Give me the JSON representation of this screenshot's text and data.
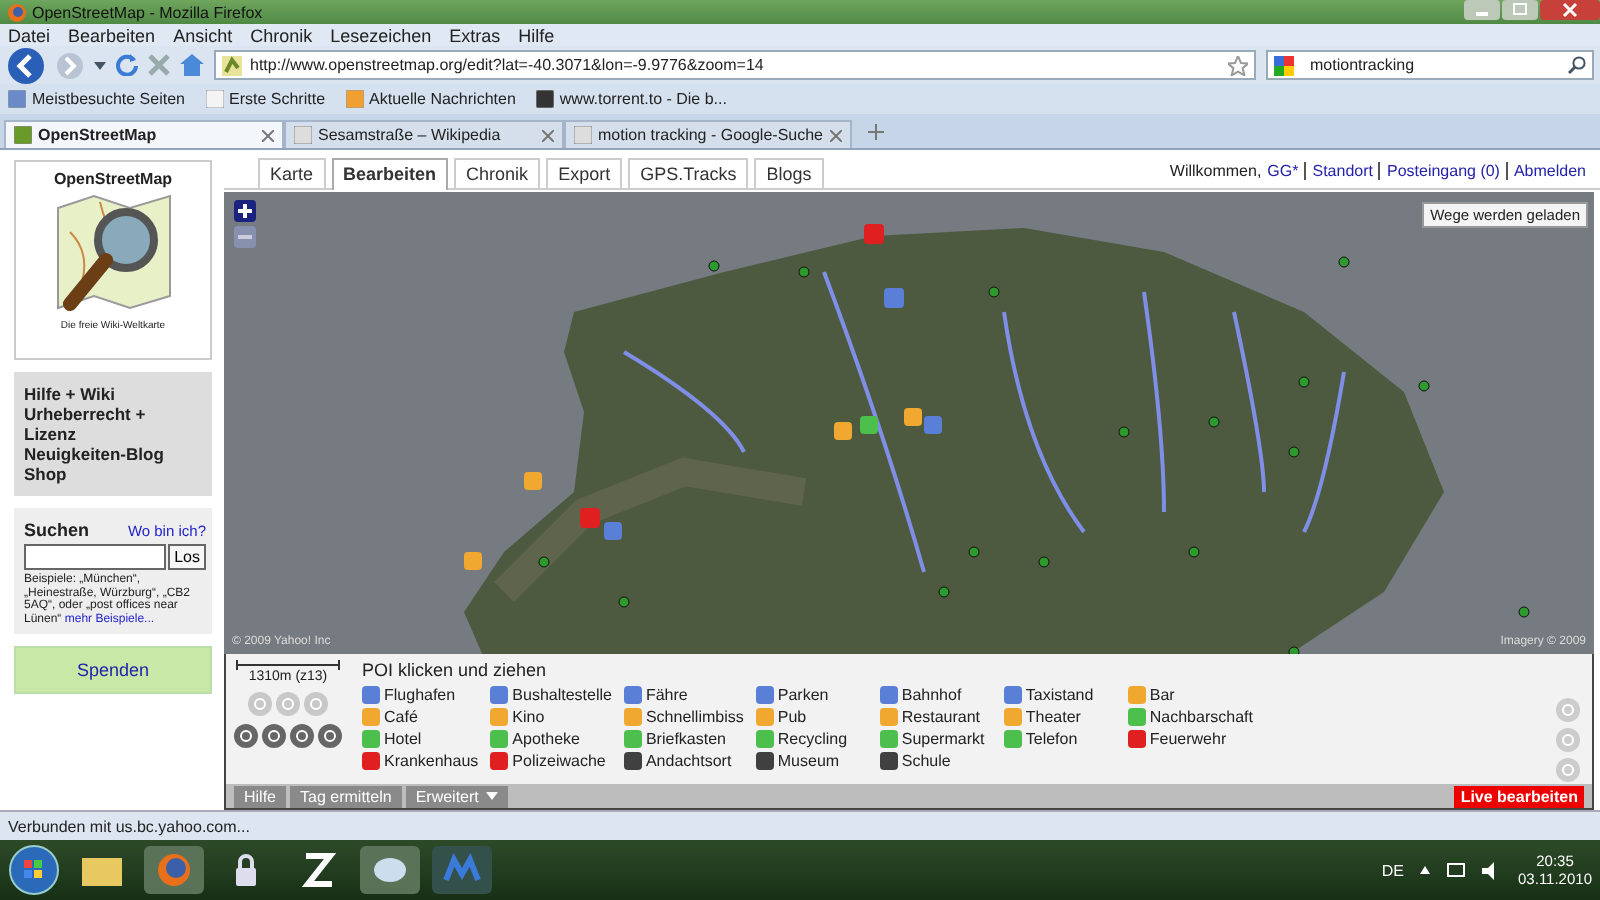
{
  "window": {
    "title": "OpenStreetMap - Mozilla Firefox"
  },
  "menu": [
    "Datei",
    "Bearbeiten",
    "Ansicht",
    "Chronik",
    "Lesezeichen",
    "Extras",
    "Hilfe"
  ],
  "address_bar": {
    "value": "http://www.openstreetmap.org/edit?lat=-40.3071&lon=-9.9776&zoom=14"
  },
  "search_field": {
    "value": "motiontracking"
  },
  "bookmarks": [
    "Meistbesuchte Seiten",
    "Erste Schritte",
    "Aktuelle Nachrichten",
    "www.torrent.to - Die b..."
  ],
  "browser_tabs": [
    {
      "label": "OpenStreetMap",
      "selected": true
    },
    {
      "label": "Sesamstraße – Wikipedia",
      "selected": false
    },
    {
      "label": "motion tracking - Google-Suche",
      "selected": false
    }
  ],
  "sidebar": {
    "logo_title": "OpenStreetMap",
    "logo_subtitle": "Die freie Wiki-Weltkarte",
    "links": [
      "Hilfe + Wiki",
      "Urheberrecht + Lizenz",
      "Neuigkeiten-Blog",
      "Shop"
    ],
    "search": {
      "heading": "Suchen",
      "locate_link": "Wo bin ich?",
      "button": "Los",
      "examples": "Beispiele: „München“, „Heinestraße, Würzburg“, „CB2 5AQ“, oder „post offices near Lünen“",
      "more_link": "mehr Beispiele..."
    },
    "donate": "Spenden"
  },
  "tabs": [
    {
      "label": "Karte",
      "selected": false
    },
    {
      "label": "Bearbeiten",
      "selected": true
    },
    {
      "label": "Chronik",
      "selected": false
    },
    {
      "label": "Export",
      "selected": false
    },
    {
      "label": "GPS.Tracks",
      "selected": false
    },
    {
      "label": "Blogs",
      "selected": false
    }
  ],
  "user_bar": {
    "greeting": "Willkommen,",
    "user": "GG*",
    "links": [
      "Standort",
      "Posteingang (0)",
      "Abmelden"
    ]
  },
  "map": {
    "loading": "Wege werden geladen",
    "copyright": "© 2009 Yahoo! Inc",
    "imagery": "Imagery © 2009"
  },
  "editor": {
    "scale": "1310m (z13)",
    "poi_title": "POI klicken und ziehen",
    "poi_columns": [
      [
        {
          "label": "Flughafen",
          "color": "#5a7fd6"
        },
        {
          "label": "Café",
          "color": "#f0a830"
        },
        {
          "label": "Hotel",
          "color": "#4cbf4c"
        },
        {
          "label": "Krankenhaus",
          "color": "#e02020"
        }
      ],
      [
        {
          "label": "Bushaltestelle",
          "color": "#5a7fd6"
        },
        {
          "label": "Kino",
          "color": "#f0a830"
        },
        {
          "label": "Apotheke",
          "color": "#4cbf4c"
        },
        {
          "label": "Polizeiwache",
          "color": "#e02020"
        }
      ],
      [
        {
          "label": "Fähre",
          "color": "#5a7fd6"
        },
        {
          "label": "Schnellimbiss",
          "color": "#f0a830"
        },
        {
          "label": "Briefkasten",
          "color": "#4cbf4c"
        },
        {
          "label": "Andachtsort",
          "color": "#404040"
        }
      ],
      [
        {
          "label": "Parken",
          "color": "#5a7fd6"
        },
        {
          "label": "Pub",
          "color": "#f0a830"
        },
        {
          "label": "Recycling",
          "color": "#4cbf4c"
        },
        {
          "label": "Museum",
          "color": "#404040"
        }
      ],
      [
        {
          "label": "Bahnhof",
          "color": "#5a7fd6"
        },
        {
          "label": "Restaurant",
          "color": "#f0a830"
        },
        {
          "label": "Supermarkt",
          "color": "#4cbf4c"
        },
        {
          "label": "Schule",
          "color": "#404040"
        }
      ],
      [
        {
          "label": "Taxistand",
          "color": "#5a7fd6"
        },
        {
          "label": "Theater",
          "color": "#f0a830"
        },
        {
          "label": "Telefon",
          "color": "#4cbf4c"
        }
      ],
      [
        {
          "label": "Bar",
          "color": "#f0a830"
        },
        {
          "label": "Nachbarschaft",
          "color": "#4cbf4c"
        },
        {
          "label": "Feuerwehr",
          "color": "#e02020"
        }
      ]
    ],
    "buttons": [
      "Hilfe",
      "Tag ermitteln",
      "Erweitert"
    ],
    "live": "Live bearbeiten"
  },
  "status_bar": "Verbunden mit us.bc.yahoo.com...",
  "taskbar": {
    "language": "DE",
    "time": "20:35",
    "date": "03.11.2010"
  }
}
